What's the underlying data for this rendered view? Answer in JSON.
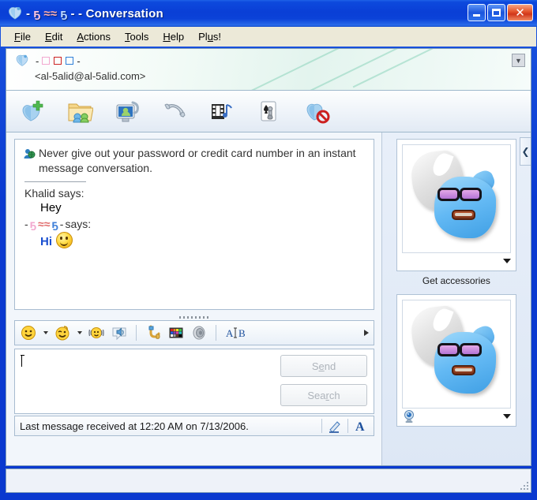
{
  "window": {
    "title_prefix": "-",
    "title_nick_pink": "ҕ",
    "title_nick_red": "≈≈",
    "title_nick_blue": "ҕ",
    "title_suffix": "- - Conversation",
    "title_icon": "msn-butterfly-icon",
    "controls": {
      "minimize": "minimize-button",
      "maximize": "maximize-button",
      "close": "close-button"
    },
    "accent_blue": "#0a3fd6",
    "close_red": "#e2512a"
  },
  "menubar": {
    "items": [
      {
        "pre": "",
        "acc": "F",
        "post": "ile"
      },
      {
        "pre": "",
        "acc": "E",
        "post": "dit"
      },
      {
        "pre": "",
        "acc": "A",
        "post": "ctions"
      },
      {
        "pre": "",
        "acc": "T",
        "post": "ools"
      },
      {
        "pre": "",
        "acc": "H",
        "post": "elp"
      },
      {
        "pre": "Pl",
        "acc": "u",
        "post": "s!"
      }
    ]
  },
  "contact_header": {
    "icon": "msn-butterfly-icon",
    "dash_left": "-",
    "dash_right": "-",
    "glyph_boxes": [
      "pink",
      "red",
      "blue"
    ],
    "email": "<al-5alid@al-5alid.com>",
    "collapse_icon": "collapse-down-icon"
  },
  "action_toolbar": {
    "buttons": [
      {
        "name": "invite-someone",
        "icon": "butterfly-plus-icon"
      },
      {
        "name": "send-file",
        "icon": "folder-contacts-icon"
      },
      {
        "name": "video-call",
        "icon": "webcam-monitor-icon"
      },
      {
        "name": "voice-call",
        "icon": "phone-handset-icon"
      },
      {
        "name": "audio-video",
        "icon": "filmstrip-note-icon"
      },
      {
        "name": "play-game",
        "icon": "card-chess-icon"
      },
      {
        "name": "block-contact",
        "icon": "butterfly-block-icon"
      }
    ]
  },
  "conversation": {
    "warning_icon": "contact-globe-icon",
    "warning_text": "Never give out your password or credit card number in an instant message conversation.",
    "messages": [
      {
        "sender_plain": "Khalid says:",
        "sender_type": "plain",
        "text": "Hey",
        "style": "black",
        "emoticon": ""
      },
      {
        "sender_type": "colored",
        "nick_dash_left": "-",
        "nick_pink": "ҕ",
        "nick_red": "≈≈",
        "nick_blue": "ҕ",
        "nick_dash_right": "-",
        "says_word": "says:",
        "text": "Hi",
        "style": "blue",
        "emoticon": "smiley-emoticon"
      }
    ],
    "splitter": "splitter-handle"
  },
  "format_toolbar": {
    "items": [
      {
        "name": "emoticon-picker",
        "icon": "smiley-icon",
        "dropdown": true
      },
      {
        "name": "wink-picker",
        "icon": "wink-face-icon",
        "dropdown": true
      },
      {
        "name": "nudge-button",
        "icon": "nudge-shake-icon",
        "dropdown": false
      },
      {
        "name": "voice-clip-button",
        "icon": "voice-bubble-icon",
        "dropdown": false
      },
      {
        "name": "backgrounds-button",
        "icon": "saxophone-icon",
        "dropdown": false
      },
      {
        "name": "color-picker-button",
        "icon": "color-palette-icon",
        "dropdown": false
      },
      {
        "name": "sound-button",
        "icon": "speaker-icon",
        "dropdown": false
      },
      {
        "name": "font-button",
        "icon": "font-ab-icon",
        "dropdown": false
      }
    ],
    "overflow_icon": "overflow-right-arrow-icon"
  },
  "input": {
    "value": "",
    "placeholder": "",
    "send_pre": "S",
    "send_acc": "e",
    "send_post": "nd",
    "search_pre": "Sea",
    "search_acc": "r",
    "search_post": "ch",
    "send_enabled": false,
    "search_enabled": false
  },
  "status_strip": {
    "text": "Last message received at 12:20 AM on 7/13/2006.",
    "handwriting_icon": "pen-handwriting-icon",
    "font_icon": "font-a-icon"
  },
  "sidebar": {
    "collapse_icon": "sidebar-collapse-left-icon",
    "contact_picture": {
      "name": "contact-display-picture",
      "alt": "blue-cartoon-face-sunglasses",
      "caption": "Get accessories",
      "dropdown_icon": "dropdown-caret-icon"
    },
    "own_picture": {
      "name": "own-display-picture",
      "alt": "blue-cartoon-face-sunglasses",
      "webcam_icon": "webcam-icon",
      "dropdown_icon": "dropdown-caret-icon"
    }
  },
  "bottom_bar": {
    "resize_grip": "resize-grip-icon"
  }
}
